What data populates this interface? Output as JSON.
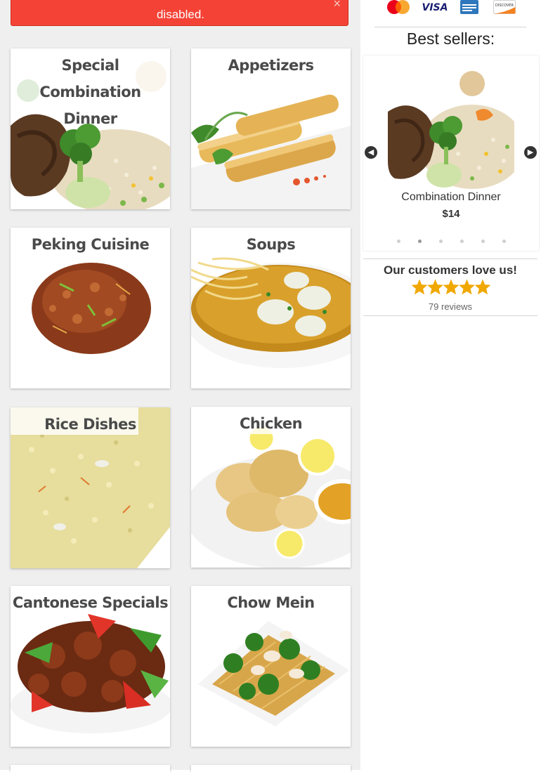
{
  "alert": {
    "message": "disabled.",
    "close_symbol": "×"
  },
  "categories": [
    {
      "title_line1": "Special Combination",
      "title_line2": "Dinner"
    },
    {
      "title": "Appetizers"
    },
    {
      "title": "Peking Cuisine"
    },
    {
      "title": "Soups"
    },
    {
      "title": "Rice Dishes"
    },
    {
      "title": "Chicken"
    },
    {
      "title": "Cantonese Specials"
    },
    {
      "title": "Chow Mein"
    }
  ],
  "payments": {
    "icons": [
      "mastercard-icon",
      "visa-icon",
      "amex-icon",
      "discover-icon"
    ],
    "visa_text": "VISA",
    "discover_text": "DISCOVER"
  },
  "best_sellers": {
    "title": "Best sellers:",
    "item_name": "Combination Dinner",
    "item_price": "$14",
    "prev_label": "Previous",
    "next_label": "Next",
    "dot_count": 6,
    "active_dot": 2
  },
  "reviews": {
    "heading": "Our customers love us!",
    "rating": 5,
    "max_rating": 5,
    "count_text": "79 reviews"
  },
  "colors": {
    "alert": "#f44336",
    "star": "#f0a800",
    "page_bg": "#efefef"
  }
}
